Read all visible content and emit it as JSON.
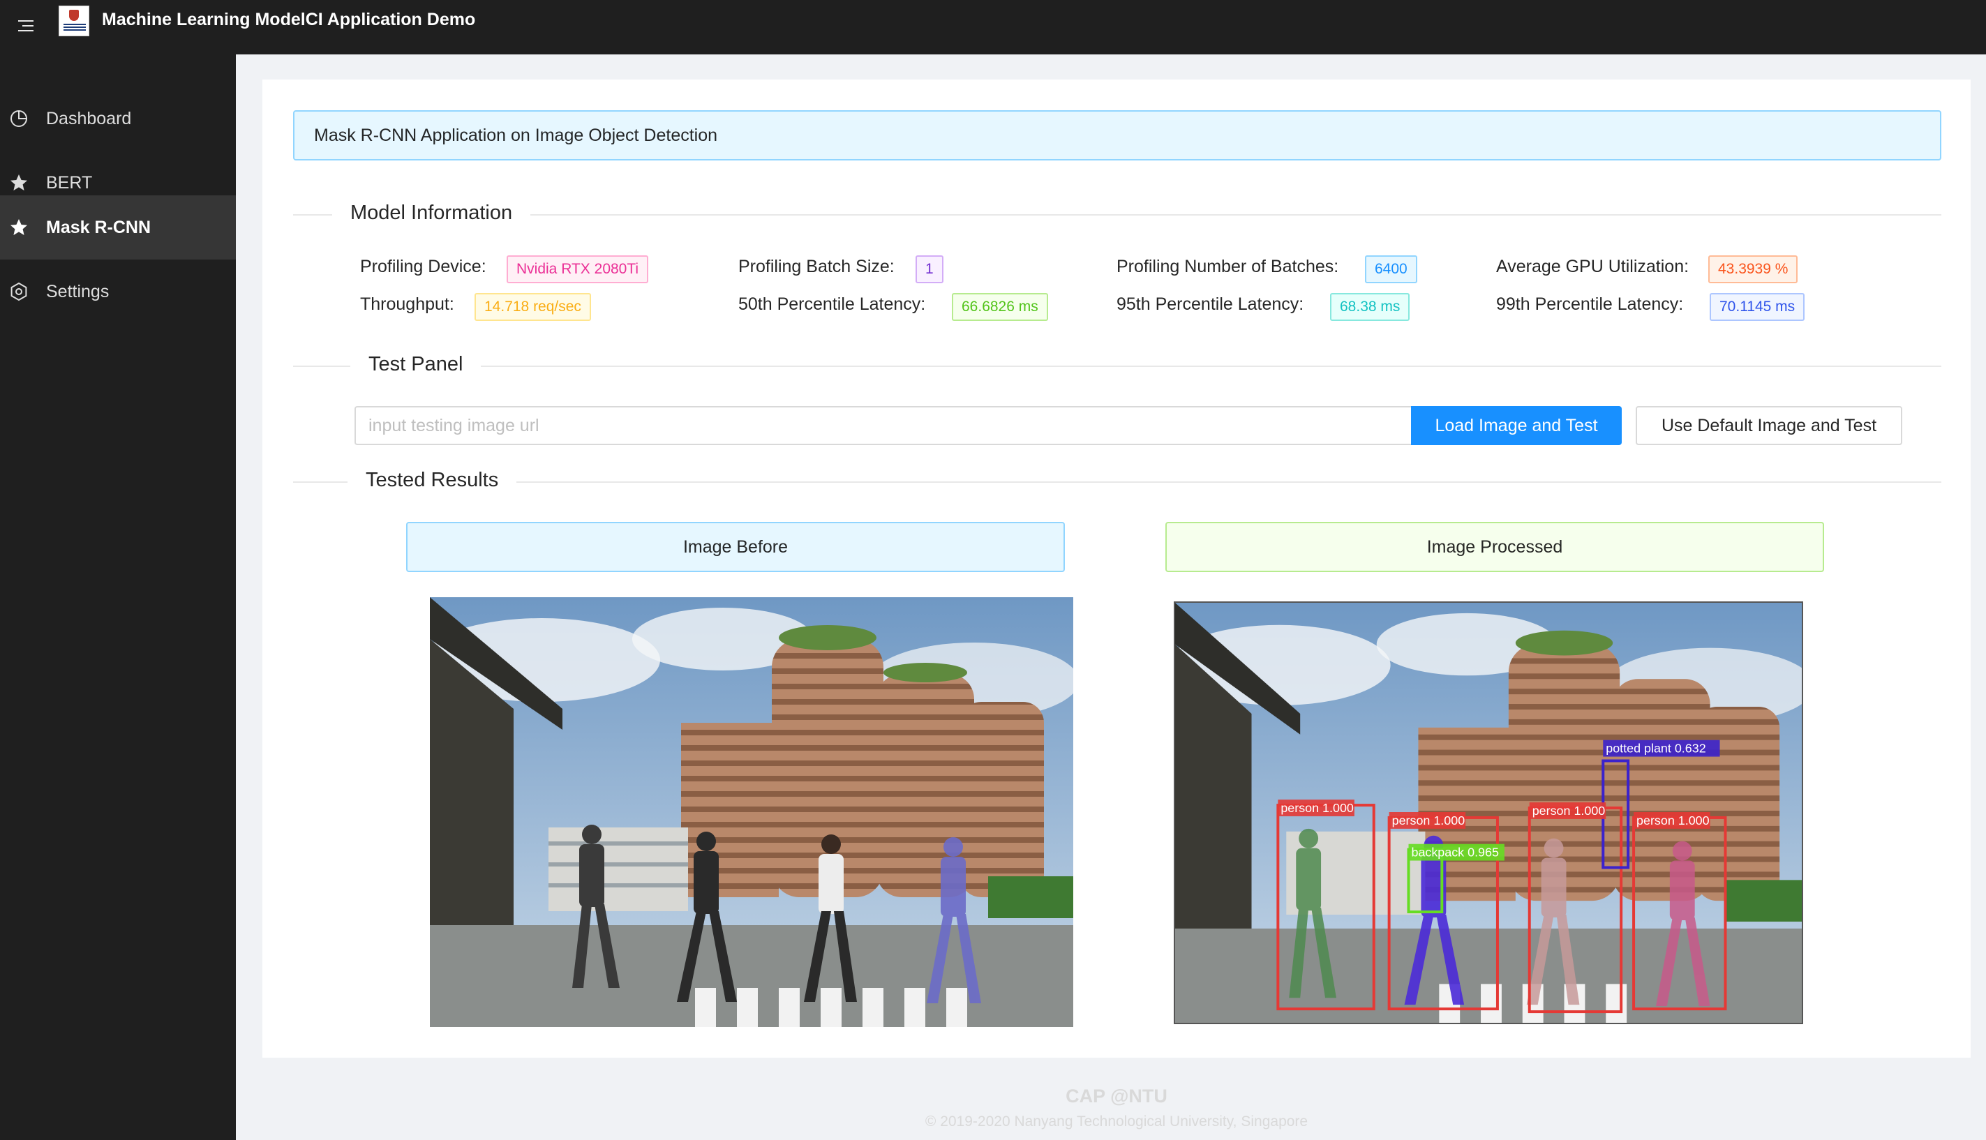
{
  "header": {
    "app_title": "Machine Learning ModelCI Application Demo",
    "menu_icon": "menu-fold-icon",
    "logo": "university-logo"
  },
  "sidebar": {
    "items": [
      {
        "label": "Dashboard",
        "icon": "pie-chart-icon",
        "active": false
      },
      {
        "label": "BERT",
        "icon": "star-icon",
        "active": false
      },
      {
        "label": "Mask R-CNN",
        "icon": "star-icon",
        "active": true
      },
      {
        "label": "Settings",
        "icon": "setting-icon",
        "active": false
      }
    ]
  },
  "main": {
    "alert_text": "Mask R-CNN Application on Image Object Detection",
    "model_info": {
      "title": "Model Information",
      "items": [
        {
          "label": "Profiling Device",
          "value": "Nvidia RTX 2080Ti",
          "color": "#eb2f96"
        },
        {
          "label": "Profiling Batch Size",
          "value": "1",
          "color": "#722ed1"
        },
        {
          "label": "Profiling Number of Batches",
          "value": "6400",
          "color": "#1890ff"
        },
        {
          "label": "Average GPU Utilization",
          "value": "43.3939 %",
          "color": "#fa541c"
        },
        {
          "label": "Throughput",
          "value": "14.718 req/sec",
          "color": "#faad14"
        },
        {
          "label": "50th Percentile Latency",
          "value": "66.6826 ms",
          "color": "#52c41a"
        },
        {
          "label": "95th Percentile Latency",
          "value": "68.38 ms",
          "color": "#13c2c2"
        },
        {
          "label": "99th Percentile Latency",
          "value": "70.1145 ms",
          "color": "#2f54eb"
        }
      ]
    },
    "test_panel": {
      "title": "Test Panel",
      "input_value": "",
      "input_placeholder": "input testing image url",
      "load_button": "Load Image and Test",
      "default_button": "Use Default Image and Test"
    },
    "results": {
      "title": "Tested Results",
      "before_label": "Image Before",
      "processed_label": "Image Processed",
      "detections": [
        {
          "label": "person 1.000",
          "color": "#e53935"
        },
        {
          "label": "person 1.000",
          "color": "#e53935"
        },
        {
          "label": "backpack 0.965",
          "color": "#66dd22"
        },
        {
          "label": "person 1.000",
          "color": "#e53935"
        },
        {
          "label": "potted plant 0.632",
          "color": "#3b22cc"
        },
        {
          "label": "person 1.000",
          "color": "#e53935"
        }
      ]
    }
  },
  "footer": {
    "brand": "CAP @NTU",
    "copyright": "© 2019-2020 Nanyang Technological University, Singapore"
  }
}
